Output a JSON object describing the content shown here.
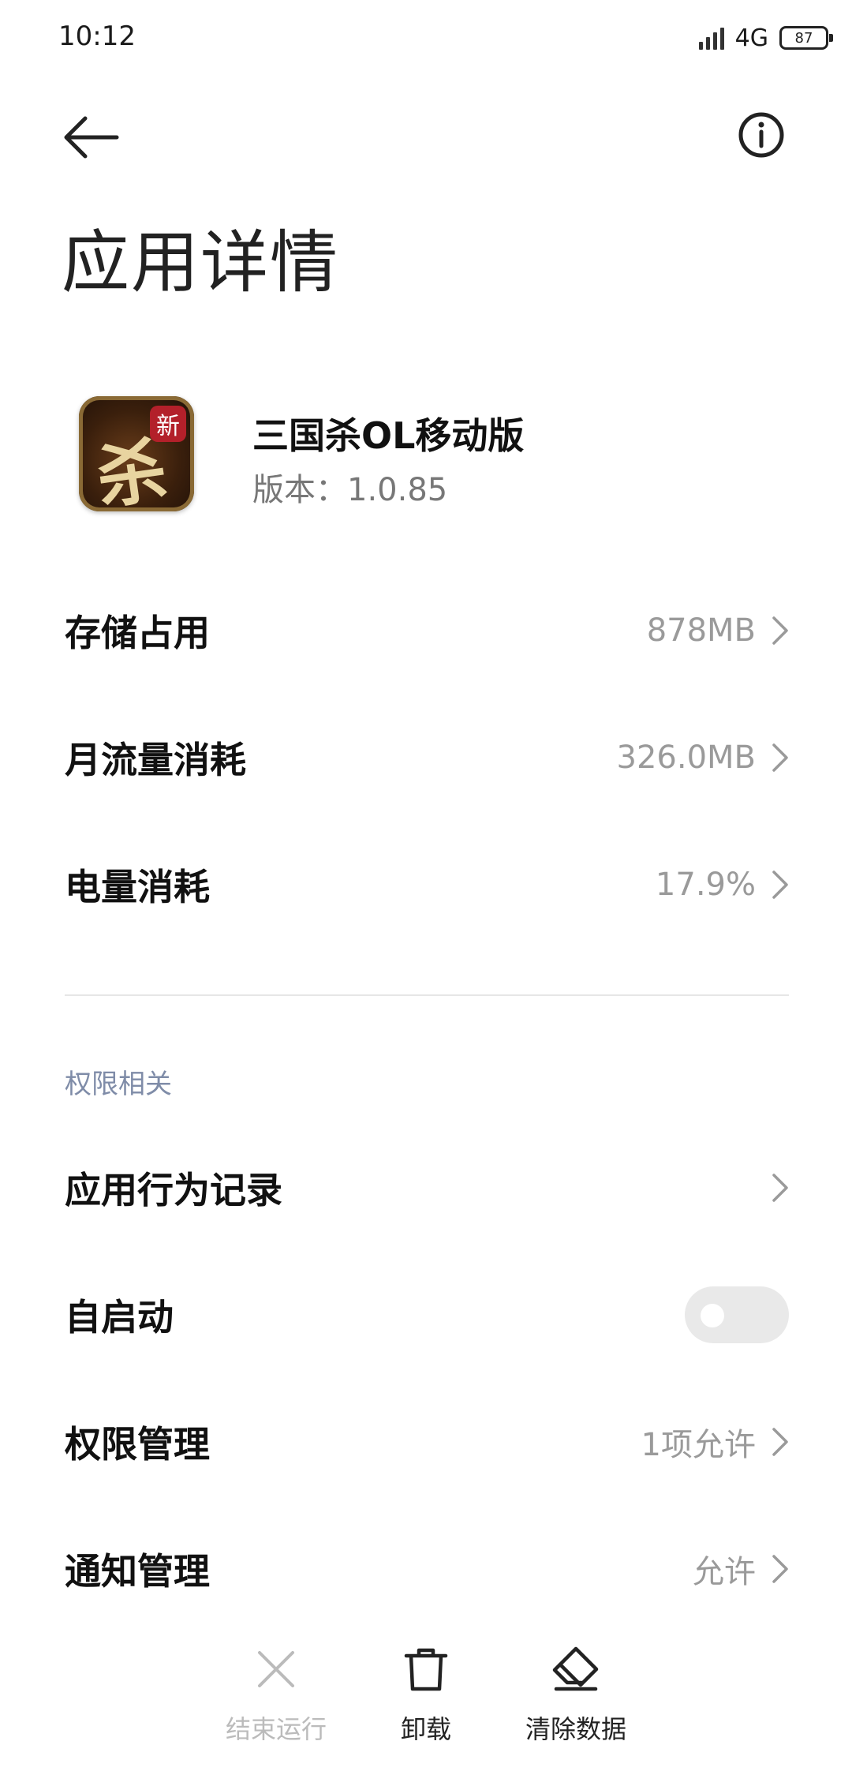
{
  "status_bar": {
    "time": "10:12",
    "network": "4G",
    "battery": "87"
  },
  "header": {
    "title": "应用详情"
  },
  "app": {
    "name": "三国杀OL移动版",
    "version": "版本：1.0.85",
    "icon_glyph": "杀",
    "icon_badge": "新"
  },
  "usage": [
    {
      "label": "存储占用",
      "value": "878MB"
    },
    {
      "label": "月流量消耗",
      "value": "326.0MB"
    },
    {
      "label": "电量消耗",
      "value": "17.9%"
    }
  ],
  "permissions": {
    "section_title": "权限相关",
    "behavior_log": {
      "label": "应用行为记录"
    },
    "autostart": {
      "label": "自启动",
      "enabled": false
    },
    "permission_mgmt": {
      "label": "权限管理",
      "value": "1项允许"
    },
    "notification_mgmt": {
      "label": "通知管理",
      "value": "允许"
    }
  },
  "actions": {
    "force_stop": {
      "label": "结束运行",
      "enabled": false
    },
    "uninstall": {
      "label": "卸载"
    },
    "clear_data": {
      "label": "清除数据"
    }
  },
  "colors": {
    "section_header": "#7f8ca8",
    "value_text": "#9a9a9a",
    "disabled": "#bbbbbb"
  }
}
